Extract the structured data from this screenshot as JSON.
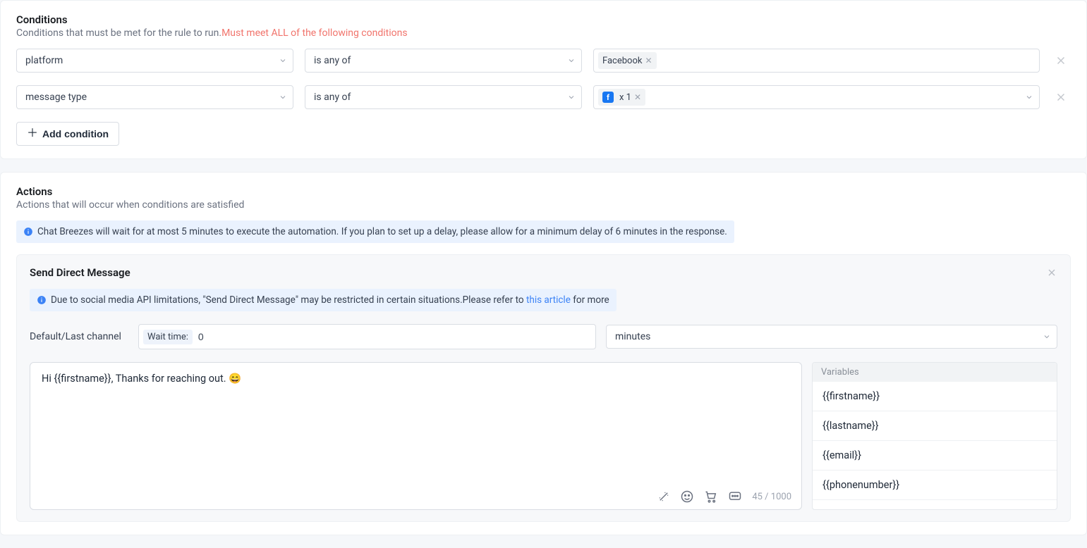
{
  "conditions": {
    "title": "Conditions",
    "desc_prefix": "Conditions that must be met for the rule to run.",
    "desc_required": "Must meet ALL of the following conditions",
    "rows": [
      {
        "field": "platform",
        "operator": "is any of",
        "tag_label": "Facebook",
        "show_fb_badge": false,
        "show_value_chevron": false
      },
      {
        "field": "message type",
        "operator": "is any of",
        "tag_label": "x 1",
        "show_fb_badge": true,
        "show_value_chevron": true
      }
    ],
    "add_label": "Add condition"
  },
  "actions": {
    "title": "Actions",
    "desc": "Actions that will occur when conditions are satisfied",
    "info": "Chat Breezes will wait for at most 5 minutes to execute the automation. If you plan to set up a delay, please allow for a minimum delay of 6 minutes in the response.",
    "card": {
      "title": "Send Direct Message",
      "info_prefix": "Due to social media API limitations, \"Send Direct Message\" may be restricted in certain situations.Please refer to ",
      "info_link": "this article",
      "info_suffix": " for more",
      "channel_label": "Default/Last channel",
      "wait_prefix": "Wait time:",
      "wait_value": "0",
      "unit": "minutes",
      "message": "Hi {{firstname}}, Thanks for reaching out. 😄",
      "counter": "45 / 1000",
      "variables_title": "Variables",
      "variables": [
        "{{firstname}}",
        "{{lastname}}",
        "{{email}}",
        "{{phonenumber}}"
      ]
    }
  }
}
